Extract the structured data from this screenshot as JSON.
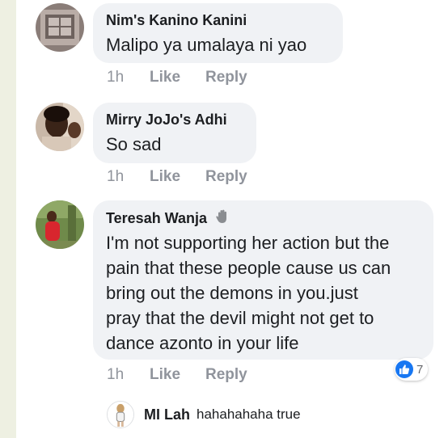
{
  "comments": [
    {
      "author": "Nim's Kanino Kanini",
      "text": "Malipo ya umalaya ni yao",
      "time": "1h",
      "like_label": "Like",
      "reply_label": "Reply",
      "avatar": "photo-avatar"
    },
    {
      "author": "Mirry JoJo's Adhi",
      "text": "So sad",
      "time": "1h",
      "like_label": "Like",
      "reply_label": "Reply",
      "avatar": "photo-avatar"
    },
    {
      "author": "Teresah Wanja",
      "author_icon": "waving-hand-icon",
      "text": "I'm not supporting her action but the\npain that these people cause us can\nbring out the demons in you.just\npray that the devil might not get to\ndance azonto in your life",
      "time": "1h",
      "like_label": "Like",
      "reply_label": "Reply",
      "reaction_icon": "thumbs-up-icon",
      "reaction_count": "7",
      "avatar": "photo-avatar"
    }
  ],
  "reply_preview": {
    "author": "MI Lah",
    "text": "hahahahaha true"
  },
  "colors": {
    "bubble": "#f0f2f5",
    "meta": "#90949c",
    "like_blue": "#1877f2",
    "rail": "#eef0e2"
  }
}
